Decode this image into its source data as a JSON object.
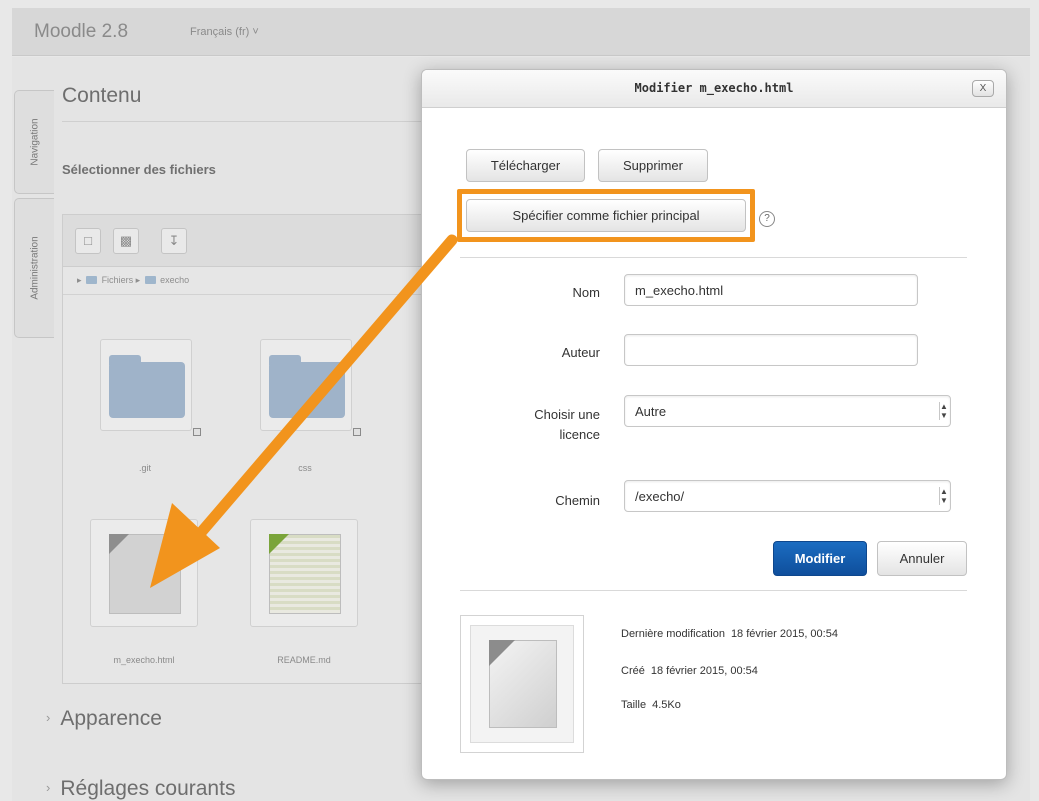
{
  "header": {
    "brand": "Moodle 2.8",
    "language": "Français (fr) ˅"
  },
  "sidebar": {
    "tabs": [
      {
        "label": "Navigation"
      },
      {
        "label": "Administration"
      }
    ]
  },
  "content": {
    "section_title": "Contenu",
    "select_files_label": "Sélectionner des fichiers",
    "file_manager": {
      "breadcrumb": {
        "root": "Fichiers",
        "folder": "execho"
      },
      "toolbar": [
        "add-file-icon",
        "create-folder-icon",
        "download-icon"
      ],
      "files": [
        {
          "name": ".git",
          "kind": "folder"
        },
        {
          "name": "css",
          "kind": "folder"
        },
        {
          "name": "m_execho.html",
          "kind": "file"
        },
        {
          "name": "README.md",
          "kind": "file"
        }
      ]
    },
    "accordion": [
      "Apparence",
      "Réglages courants"
    ]
  },
  "dialog": {
    "title": "Modifier m_execho.html",
    "close_label": "X",
    "buttons": {
      "download": "Télécharger",
      "delete": "Supprimer",
      "set_main": "Spécifier comme fichier principal",
      "help": "?"
    },
    "form": {
      "name_label": "Nom",
      "name_value": "m_execho.html",
      "author_label": "Auteur",
      "author_value": "",
      "license_label": "Choisir une licence",
      "license_value": "Autre",
      "path_label": "Chemin",
      "path_value": "/execho/"
    },
    "actions": {
      "submit": "Modifier",
      "cancel": "Annuler"
    },
    "info": {
      "modified_label": "Dernière modification",
      "modified_value": "18 février 2015, 00:54",
      "created_label": "Créé",
      "created_value": "18 février 2015, 00:54",
      "size_label": "Taille",
      "size_value": "4.5Ko"
    }
  },
  "colors": {
    "highlight": "#f2941d",
    "primary_button": "#0f4f9c"
  }
}
